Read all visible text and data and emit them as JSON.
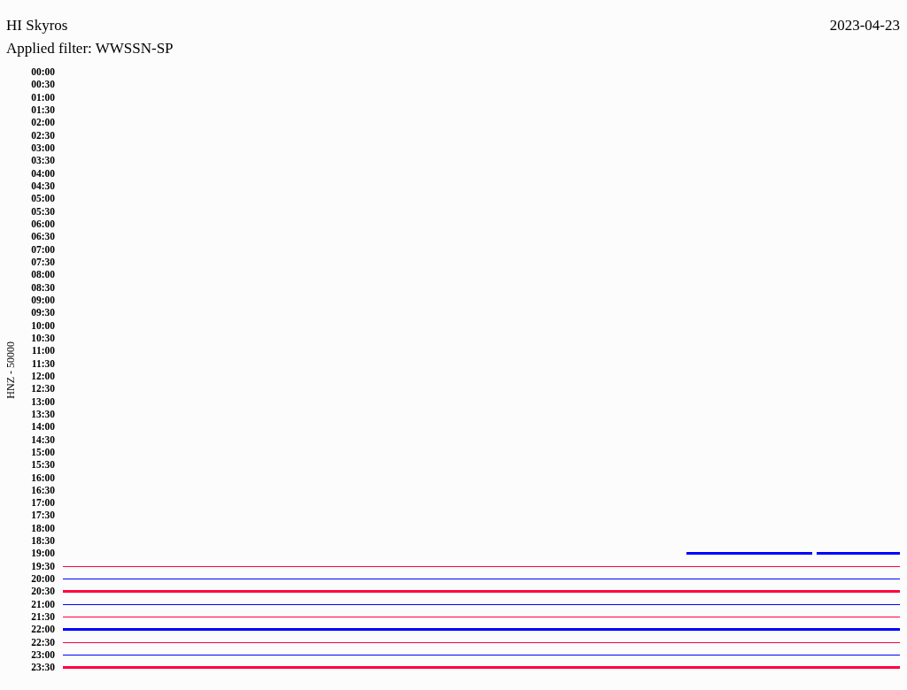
{
  "header": {
    "station": "HI Skyros",
    "date": "2023-04-23",
    "filter": "Applied filter: WWSSN-SP"
  },
  "plot": {
    "ylabel": "HNZ - 50000",
    "rows": [
      {
        "time": "00:00",
        "kind": "empty"
      },
      {
        "time": "00:30",
        "kind": "empty"
      },
      {
        "time": "01:00",
        "kind": "empty"
      },
      {
        "time": "01:30",
        "kind": "empty"
      },
      {
        "time": "02:00",
        "kind": "empty"
      },
      {
        "time": "02:30",
        "kind": "empty"
      },
      {
        "time": "03:00",
        "kind": "empty"
      },
      {
        "time": "03:30",
        "kind": "empty"
      },
      {
        "time": "04:00",
        "kind": "empty"
      },
      {
        "time": "04:30",
        "kind": "empty"
      },
      {
        "time": "05:00",
        "kind": "empty"
      },
      {
        "time": "05:30",
        "kind": "empty"
      },
      {
        "time": "06:00",
        "kind": "empty"
      },
      {
        "time": "06:30",
        "kind": "empty"
      },
      {
        "time": "07:00",
        "kind": "empty"
      },
      {
        "time": "07:30",
        "kind": "empty"
      },
      {
        "time": "08:00",
        "kind": "empty"
      },
      {
        "time": "08:30",
        "kind": "empty"
      },
      {
        "time": "09:00",
        "kind": "empty"
      },
      {
        "time": "09:30",
        "kind": "empty"
      },
      {
        "time": "10:00",
        "kind": "empty"
      },
      {
        "time": "10:30",
        "kind": "empty"
      },
      {
        "time": "11:00",
        "kind": "empty"
      },
      {
        "time": "11:30",
        "kind": "empty"
      },
      {
        "time": "12:00",
        "kind": "empty"
      },
      {
        "time": "12:30",
        "kind": "empty"
      },
      {
        "time": "13:00",
        "kind": "empty"
      },
      {
        "time": "13:30",
        "kind": "empty"
      },
      {
        "time": "14:00",
        "kind": "empty"
      },
      {
        "time": "14:30",
        "kind": "empty"
      },
      {
        "time": "15:00",
        "kind": "empty"
      },
      {
        "time": "15:30",
        "kind": "empty"
      },
      {
        "time": "16:00",
        "kind": "empty"
      },
      {
        "time": "16:30",
        "kind": "empty"
      },
      {
        "time": "17:00",
        "kind": "empty"
      },
      {
        "time": "17:30",
        "kind": "empty"
      },
      {
        "time": "18:00",
        "kind": "empty"
      },
      {
        "time": "18:30",
        "kind": "empty"
      },
      {
        "time": "19:00",
        "kind": "partial",
        "color": "#0000ff",
        "thick": true
      },
      {
        "time": "19:30",
        "kind": "full",
        "color": "#ff0040",
        "thick": false
      },
      {
        "time": "20:00",
        "kind": "full",
        "color": "#0000ff",
        "thick": false
      },
      {
        "time": "20:30",
        "kind": "full",
        "color": "#ff0040",
        "thick": true
      },
      {
        "time": "21:00",
        "kind": "full",
        "color": "#0000ff",
        "thick": false
      },
      {
        "time": "21:30",
        "kind": "full",
        "color": "#ff0040",
        "thick": false
      },
      {
        "time": "22:00",
        "kind": "full",
        "color": "#0000ff",
        "thick": true
      },
      {
        "time": "22:30",
        "kind": "full",
        "color": "#ff0040",
        "thick": false
      },
      {
        "time": "23:00",
        "kind": "full",
        "color": "#0000ff",
        "thick": false
      },
      {
        "time": "23:30",
        "kind": "full",
        "color": "#ff0040",
        "thick": true
      }
    ]
  }
}
